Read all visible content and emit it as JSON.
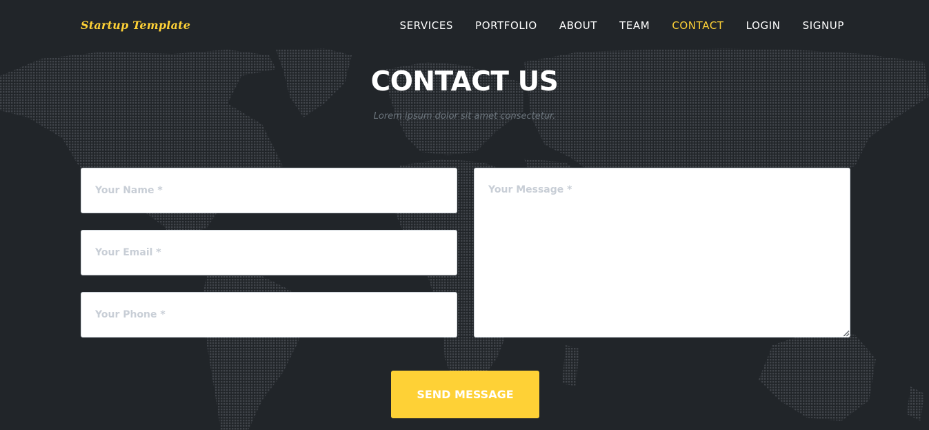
{
  "nav": {
    "brand": "Startup Template",
    "items": [
      {
        "label": "SERVICES",
        "active": false
      },
      {
        "label": "PORTFOLIO",
        "active": false
      },
      {
        "label": "ABOUT",
        "active": false
      },
      {
        "label": "TEAM",
        "active": false
      },
      {
        "label": "CONTACT",
        "active": true
      },
      {
        "label": "LOGIN",
        "active": false
      },
      {
        "label": "SIGNUP",
        "active": false
      }
    ]
  },
  "contact": {
    "title": "CONTACT US",
    "subtitle": "Lorem ipsum dolor sit amet consectetur.",
    "name_placeholder": "Your Name *",
    "email_placeholder": "Your Email *",
    "phone_placeholder": "Your Phone *",
    "message_placeholder": "Your Message *",
    "submit_label": "SEND MESSAGE"
  },
  "colors": {
    "background": "#212529",
    "accent": "#fed136",
    "map_dots": "#3d4146",
    "subtitle": "#6c757d"
  },
  "icons": {
    "background_map": "world-map-dots-icon",
    "resize": "resize-grip-icon"
  }
}
